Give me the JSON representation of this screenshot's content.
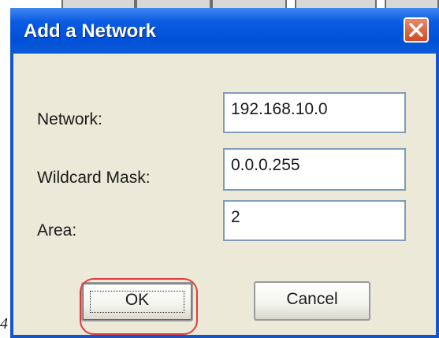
{
  "dialog": {
    "title": "Add a Network",
    "close_icon": "close-icon"
  },
  "form": {
    "network_label": "Network:",
    "network_value": "192.168.10.0",
    "wildcard_label": "Wildcard Mask:",
    "wildcard_value": "0.0.0.255",
    "area_label": "Area:",
    "area_value": "2"
  },
  "buttons": {
    "ok_label": "OK",
    "cancel_label": "Cancel"
  },
  "stray_text": "4",
  "colors": {
    "title_bar": "#0050d8",
    "dialog_body": "#ece9d8",
    "close_button": "#d14a26",
    "highlight": "#e23c3c"
  }
}
